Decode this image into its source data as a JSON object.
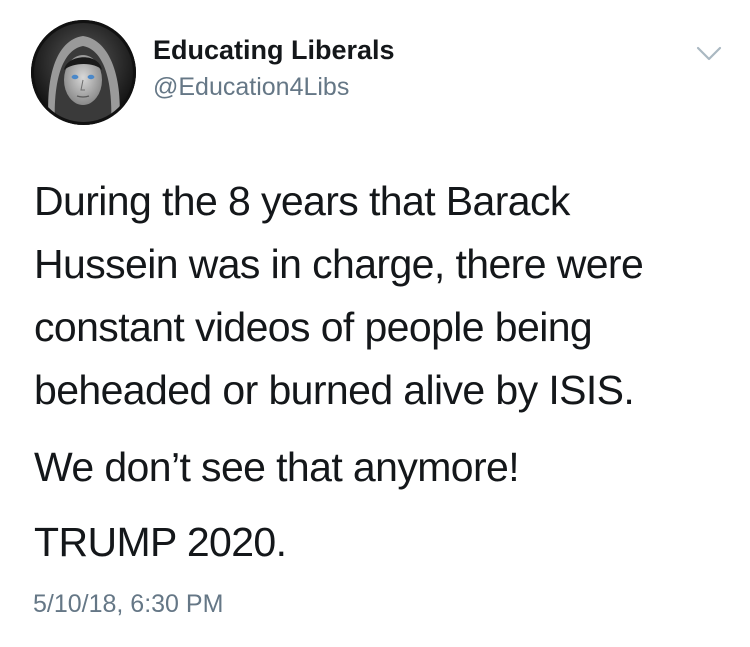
{
  "tweet": {
    "author": {
      "display_name": "Educating Liberals",
      "handle": "@Education4Libs",
      "avatar_icon": "profile-photo-bw"
    },
    "menu_icon": "chevron-down-icon",
    "body": {
      "paragraph1_lines": [
        "During the 8 years that Barack",
        "Hussein was in charge, there were",
        "constant videos of people being",
        "beheaded or burned alive by ISIS."
      ],
      "paragraph2": "We don’t see that anymore!",
      "paragraph3": "TRUMP 2020."
    },
    "timestamp": "5/10/18, 6:30 PM"
  },
  "colors": {
    "text": "#14171a",
    "secondary_text": "#657786",
    "background": "#ffffff",
    "chevron": "#aab8c2"
  }
}
